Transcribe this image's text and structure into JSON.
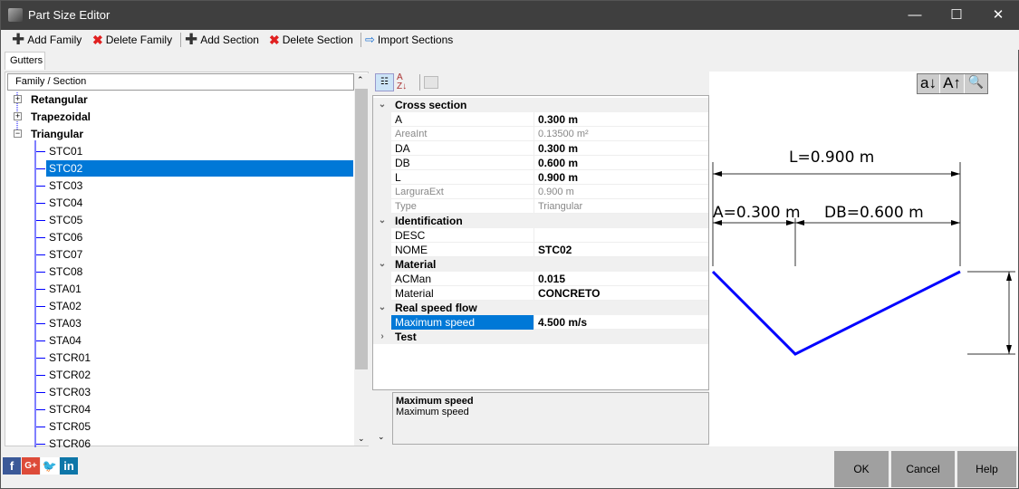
{
  "window": {
    "title": "Part Size Editor",
    "minimize": "—",
    "maximize": "☐",
    "close": "✕"
  },
  "toolbar": {
    "add_family": "Add Family",
    "delete_family": "Delete Family",
    "add_section": "Add Section",
    "delete_section": "Delete Section",
    "import_sections": "Import Sections"
  },
  "tab": "Gutters",
  "tree": {
    "header": "Family / Section",
    "families": [
      {
        "label": "Retangular",
        "expanded": false
      },
      {
        "label": "Trapezoidal",
        "expanded": false
      },
      {
        "label": "Triangular",
        "expanded": true
      }
    ],
    "sections": [
      "STC01",
      "STC02",
      "STC03",
      "STC04",
      "STC05",
      "STC06",
      "STC07",
      "STC08",
      "STA01",
      "STA02",
      "STA03",
      "STA04",
      "STCR01",
      "STCR02",
      "STCR03",
      "STCR04",
      "STCR05",
      "STCR06"
    ],
    "selected": "STC02"
  },
  "properties": {
    "rows": [
      {
        "type": "cat",
        "name": "Cross section",
        "expanded": true
      },
      {
        "name": "A",
        "value": "0.300 m",
        "style": "bold"
      },
      {
        "name": "AreaInt",
        "value": "0.13500 m²",
        "style": "ro"
      },
      {
        "name": "DA",
        "value": "0.300 m",
        "style": "bold"
      },
      {
        "name": "DB",
        "value": "0.600 m",
        "style": "bold"
      },
      {
        "name": "L",
        "value": "0.900 m",
        "style": "bold"
      },
      {
        "name": "LarguraExt",
        "value": "0.900 m",
        "style": "ro"
      },
      {
        "name": "Type",
        "value": "Triangular",
        "style": "ro"
      },
      {
        "type": "cat",
        "name": "Identification",
        "expanded": true
      },
      {
        "name": "DESC",
        "value": "",
        "style": ""
      },
      {
        "name": "NOME",
        "value": "STC02",
        "style": "bold"
      },
      {
        "type": "cat",
        "name": "Material",
        "expanded": true
      },
      {
        "name": "ACMan",
        "value": "0.015",
        "style": "bold"
      },
      {
        "name": "Material",
        "value": "CONCRETO",
        "style": "bold"
      },
      {
        "type": "cat",
        "name": "Real speed flow",
        "expanded": true
      },
      {
        "name": "Maximum speed",
        "value": "4.500 m/s",
        "style": "bold",
        "selected": true
      },
      {
        "type": "cat",
        "name": "Test",
        "expanded": false
      }
    ],
    "description": {
      "title": "Maximum speed",
      "text": "Maximum speed"
    }
  },
  "drawing": {
    "L_label": "L=0.900 m",
    "A_label": "A=0.300 m",
    "DB_label": "DB=0.600 m",
    "line_color": "#0000ff",
    "tools": [
      "a↓",
      "A↑",
      "zoom-fit"
    ]
  },
  "buttons": {
    "ok": "OK",
    "cancel": "Cancel",
    "help": "Help"
  },
  "social": [
    "facebook",
    "google-plus",
    "twitter",
    "linkedin"
  ]
}
